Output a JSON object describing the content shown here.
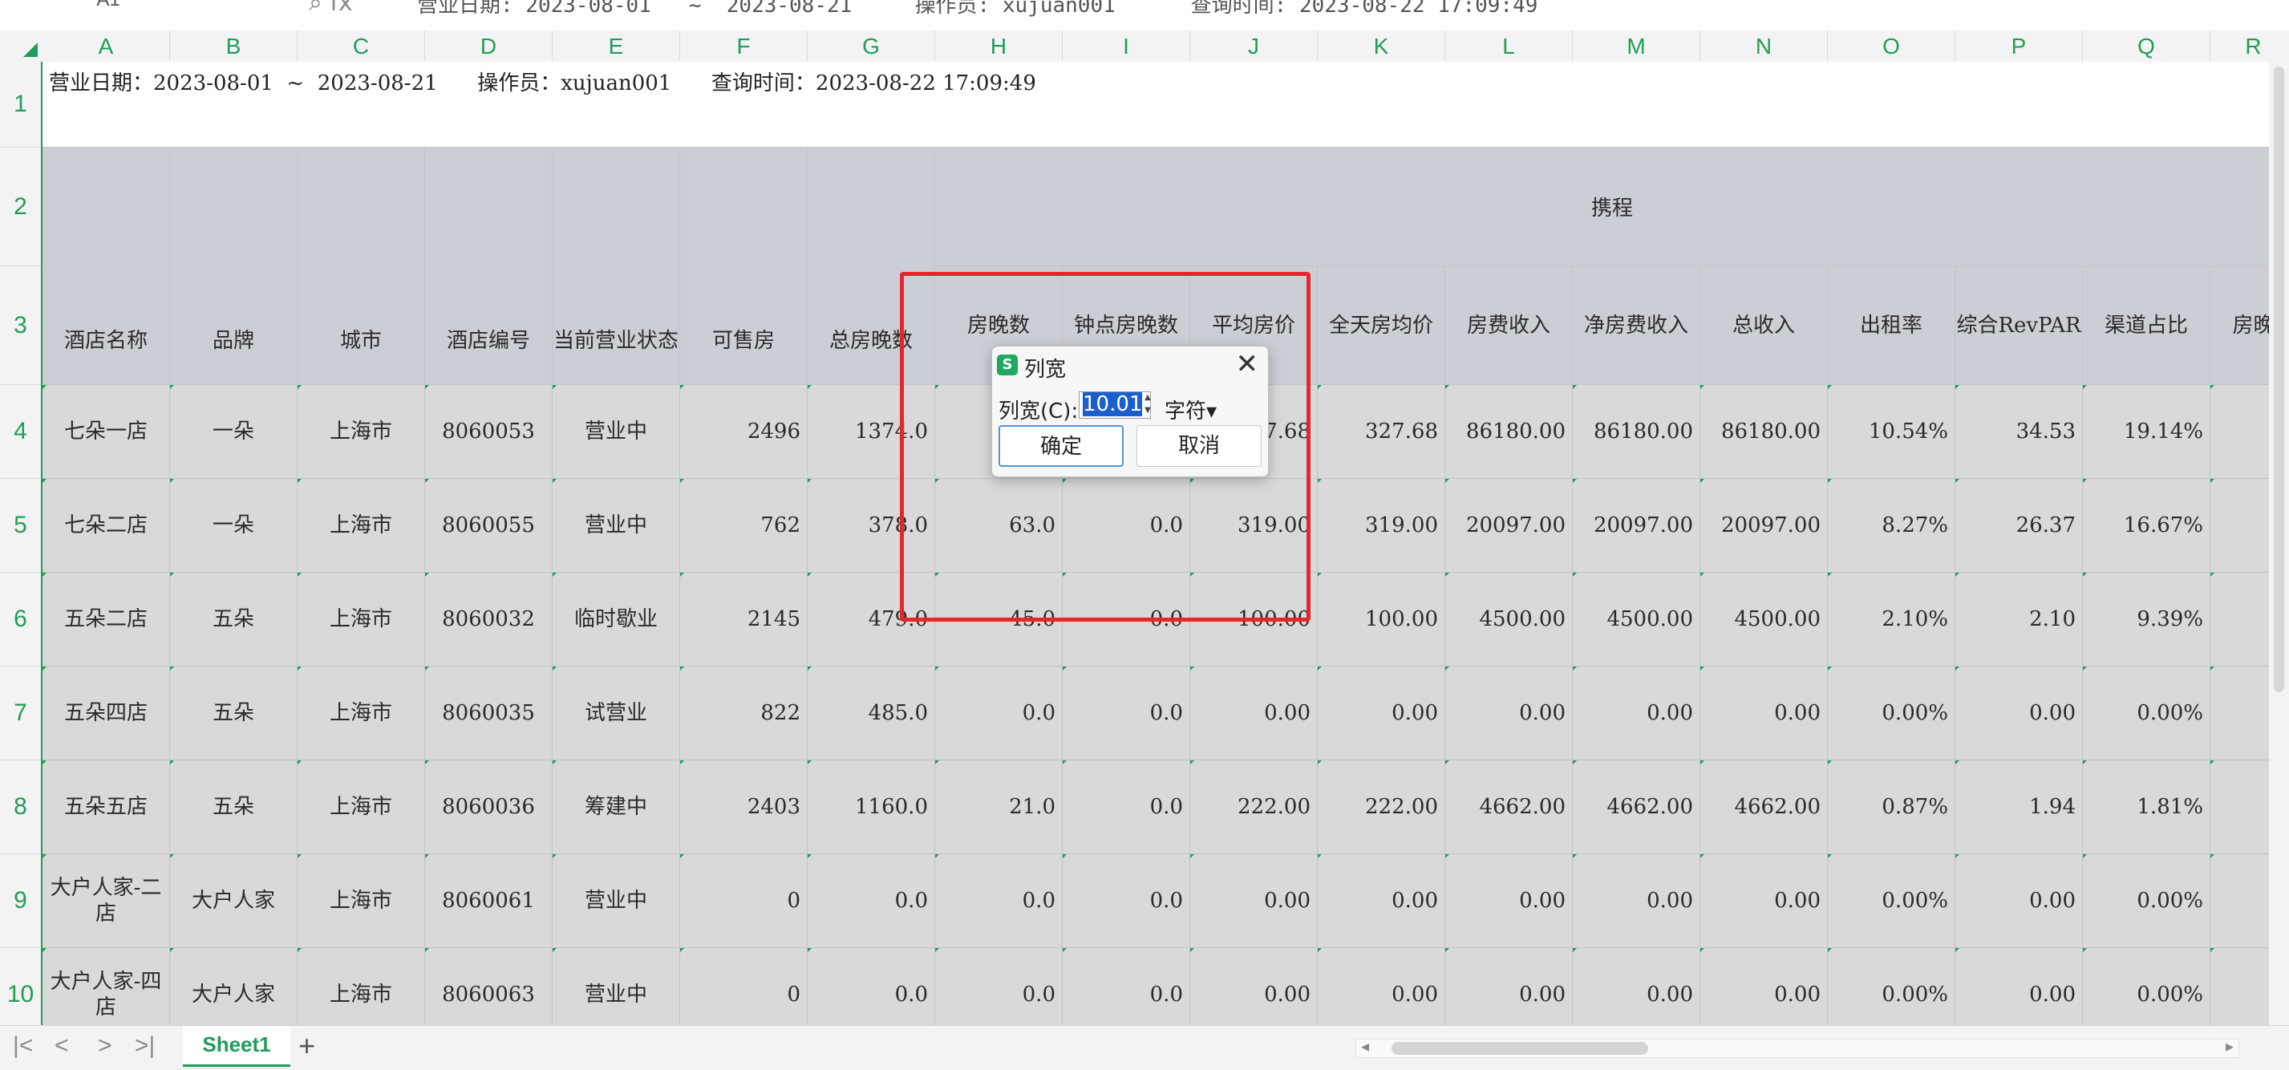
{
  "formula_bar": {
    "name_box": "A1",
    "fx": "fx",
    "formula": "营业日期: 2023-08-01   ~  2023-08-21     操作员: xujuan001      查询时间: 2023-08-22 17:09:49"
  },
  "columns": [
    "A",
    "B",
    "C",
    "D",
    "E",
    "F",
    "G",
    "H",
    "I",
    "J",
    "K",
    "L",
    "M",
    "N",
    "O",
    "P",
    "Q",
    "R"
  ],
  "rows": [
    "1",
    "2",
    "3",
    "4",
    "5",
    "6",
    "7",
    "8",
    "9",
    "10"
  ],
  "row1_text": "营业日期：2023-08-01  ~  2023-08-21      操作员：xujuan001      查询时间：2023-08-22 17:09:49",
  "ctrip_label": "携程",
  "headers": [
    "酒店名称",
    "品牌",
    "城市",
    "酒店编号",
    "当前营业状态",
    "可售房",
    "总房晚数",
    "房晚数",
    "钟点房晚数",
    "平均房价",
    "全天房均价",
    "房费收入",
    "净房费收入",
    "总收入",
    "出租率",
    "综合RevPAR",
    "渠道占比",
    "房晚"
  ],
  "data_rows": [
    [
      "七朵一店",
      "一朵",
      "上海市",
      "8060053",
      "营业中",
      "2496",
      "1374.0",
      "",
      "",
      "327.68",
      "327.68",
      "86180.00",
      "86180.00",
      "86180.00",
      "10.54%",
      "34.53",
      "19.14%",
      ""
    ],
    [
      "七朵二店",
      "一朵",
      "上海市",
      "8060055",
      "营业中",
      "762",
      "378.0",
      "63.0",
      "0.0",
      "319.00",
      "319.00",
      "20097.00",
      "20097.00",
      "20097.00",
      "8.27%",
      "26.37",
      "16.67%",
      ""
    ],
    [
      "五朵二店",
      "五朵",
      "上海市",
      "8060032",
      "临时歇业",
      "2145",
      "479.0",
      "45.0",
      "0.0",
      "100.00",
      "100.00",
      "4500.00",
      "4500.00",
      "4500.00",
      "2.10%",
      "2.10",
      "9.39%",
      ""
    ],
    [
      "五朵四店",
      "五朵",
      "上海市",
      "8060035",
      "试营业",
      "822",
      "485.0",
      "0.0",
      "0.0",
      "0.00",
      "0.00",
      "0.00",
      "0.00",
      "0.00",
      "0.00%",
      "0.00",
      "0.00%",
      ""
    ],
    [
      "五朵五店",
      "五朵",
      "上海市",
      "8060036",
      "筹建中",
      "2403",
      "1160.0",
      "21.0",
      "0.0",
      "222.00",
      "222.00",
      "4662.00",
      "4662.00",
      "4662.00",
      "0.87%",
      "1.94",
      "1.81%",
      ""
    ],
    [
      "大户人家-二店",
      "大户人家",
      "上海市",
      "8060061",
      "营业中",
      "0",
      "0.0",
      "0.0",
      "0.0",
      "0.00",
      "0.00",
      "0.00",
      "0.00",
      "0.00",
      "0.00%",
      "0.00",
      "0.00%",
      ""
    ],
    [
      "大户人家-四店",
      "大户人家",
      "上海市",
      "8060063",
      "营业中",
      "0",
      "0.0",
      "0.0",
      "0.0",
      "0.00",
      "0.00",
      "0.00",
      "0.00",
      "0.00",
      "0.00%",
      "0.00",
      "0.00%",
      ""
    ]
  ],
  "dialog": {
    "icon": "S",
    "title": "列宽",
    "close": "✕",
    "field_label": "列宽(C):",
    "value": "10.01",
    "unit": "字符▾",
    "ok": "确定",
    "cancel": "取消"
  },
  "tabbar": {
    "first": "|<",
    "prev": "<",
    "next": ">",
    "last": ">|",
    "sheet": "Sheet1",
    "add": "+"
  },
  "colors": {
    "accent": "#1f9d5a",
    "annotation": "#e8262a",
    "header_bg": "#cbced4",
    "body_bg": "#d9d9d9"
  }
}
